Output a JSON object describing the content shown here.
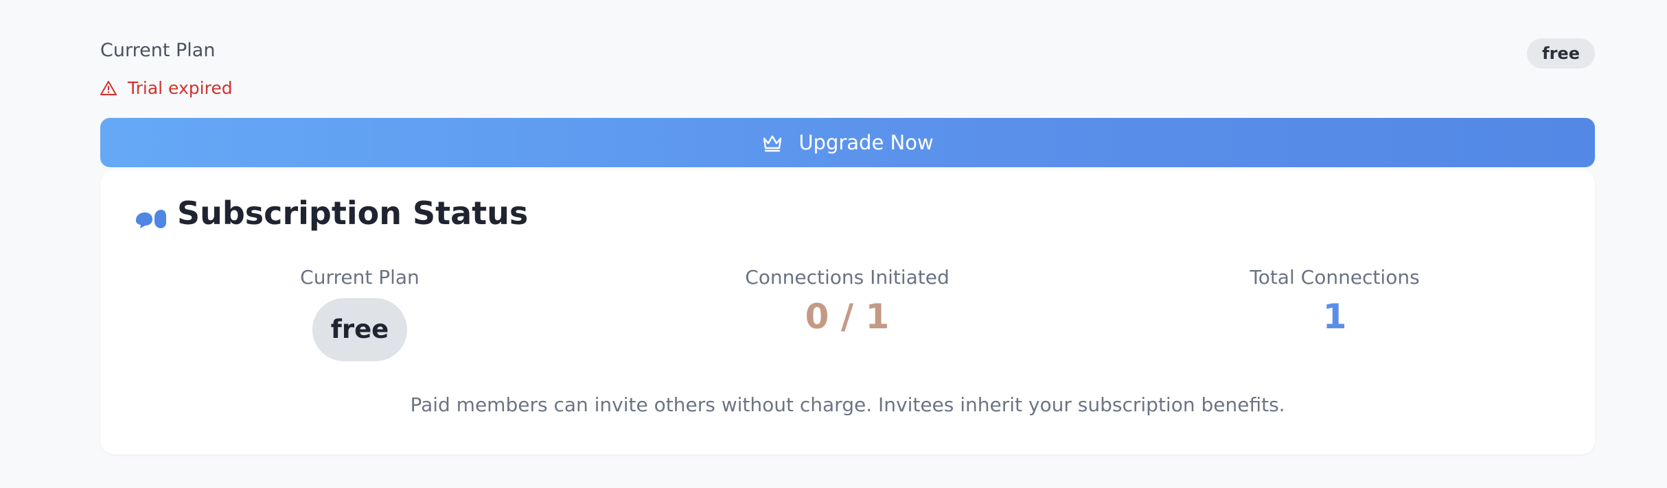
{
  "header": {
    "title": "Current Plan",
    "plan_badge": "free"
  },
  "alert": {
    "icon": "warning-triangle-icon",
    "text": "Trial expired",
    "color": "#d0312d"
  },
  "upgrade_button": {
    "icon": "crown-icon",
    "label": "Upgrade Now"
  },
  "subscription_card": {
    "icon": "chat-bubbles-icon",
    "title": "Subscription Status",
    "stats": [
      {
        "label": "Current Plan",
        "value": "free"
      },
      {
        "label": "Connections Initiated",
        "value": "0 / 1",
        "color": "#c49a86"
      },
      {
        "label": "Total Connections",
        "value": "1",
        "color": "#5b8ee8"
      }
    ],
    "note": "Paid members can invite others without charge. Invitees inherit your subscription benefits."
  }
}
